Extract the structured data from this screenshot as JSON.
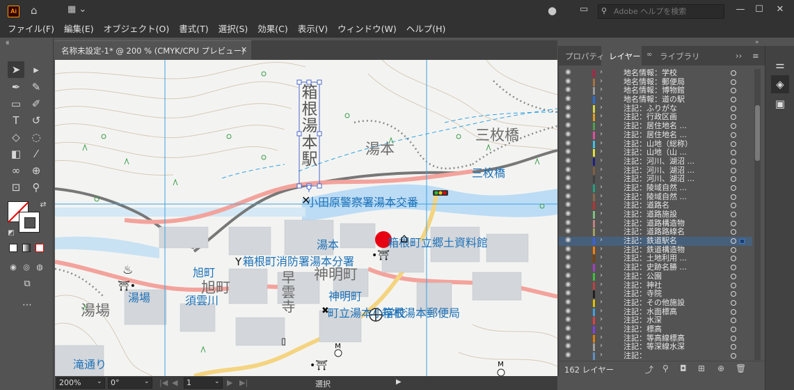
{
  "app": {
    "logo": "Ai",
    "search_placeholder": "Adobe ヘルプを検索"
  },
  "menu": [
    "ファイル(F)",
    "編集(E)",
    "オブジェクト(O)",
    "書式(T)",
    "選択(S)",
    "効果(C)",
    "表示(V)",
    "ウィンドウ(W)",
    "ヘルプ(H)"
  ],
  "document": {
    "tab_label": "名称未設定-1* @ 200 % (CMYK/CPU プレビュー)",
    "close_glyph": "✕"
  },
  "statusbar": {
    "zoom": "200%",
    "rotation": "0°",
    "artboard": "1",
    "mode": "選択"
  },
  "map": {
    "vertical_labels": [
      {
        "text": "箱根湯本駅"
      },
      {
        "text": "早雲寺"
      }
    ],
    "gray_labels": [
      "三枚橋",
      "湯本",
      "旭町",
      "湯場",
      "神明町"
    ],
    "blue_labels": [
      "三枚橋",
      "小田原警察署湯本交番",
      "湯本",
      "箱根町消防署湯本分署",
      "旭町",
      "湯場",
      "須雲川",
      "神明町",
      "町立湯本小学校",
      "箱根湯本郵便局",
      "箱根町立郷土資料館",
      "滝通り"
    ]
  },
  "panel": {
    "tabs": [
      "プロパティ",
      "レイヤー",
      "ライブラリ"
    ],
    "active_tab": "レイヤー",
    "footer_count": "162 レイヤー",
    "layers": [
      {
        "name": "地名情報：学校",
        "color": "#b81f45"
      },
      {
        "name": "地名情報：郵便局",
        "color": "#a87342"
      },
      {
        "name": "地名情報：博物館",
        "color": "#9a9a9a"
      },
      {
        "name": "地名情報：道の駅",
        "color": "#2c6dd6"
      },
      {
        "name": "注記：ふりがな",
        "color": "#d6d640"
      },
      {
        "name": "注記：行政区画",
        "color": "#e0a020"
      },
      {
        "name": "注記：居住地名 ...",
        "color": "#50a050"
      },
      {
        "name": "注記：居住地名 ...",
        "color": "#e050a0"
      },
      {
        "name": "注記：山地（総称）",
        "color": "#40c0e0"
      },
      {
        "name": "注記：山地（山 ...",
        "color": "#e0e040"
      },
      {
        "name": "注記：河川、湖沼 ...",
        "color": "#202080"
      },
      {
        "name": "注記：河川、湖沼 ...",
        "color": "#806040"
      },
      {
        "name": "注記：河川、湖沼 ...",
        "color": "#404040"
      },
      {
        "name": "注記：陵域自然 ...",
        "color": "#20a080"
      },
      {
        "name": "注記：陵域自然 ...",
        "color": "#8a6a4a"
      },
      {
        "name": "注記：道路名",
        "color": "#c03030"
      },
      {
        "name": "注記：道路施設",
        "color": "#80c080"
      },
      {
        "name": "注記：道路構造物",
        "color": "#c08080"
      },
      {
        "name": "注記：道路路線名",
        "color": "#a0a060"
      },
      {
        "name": "注記：鉄道駅名",
        "color": "#4060e0",
        "selected": true
      },
      {
        "name": "注記：鉄道構造物",
        "color": "#ff8000"
      },
      {
        "name": "注記：土地利用 ...",
        "color": "#804000"
      },
      {
        "name": "注記：史跡名勝 ...",
        "color": "#a040c0"
      },
      {
        "name": "注記：公園",
        "color": "#40c040"
      },
      {
        "name": "注記：神社",
        "color": "#c04040"
      },
      {
        "name": "注記：寺院",
        "color": "#202020"
      },
      {
        "name": "注記：その他施設",
        "color": "#e0c000"
      },
      {
        "name": "注記：水面標高",
        "color": "#40a0e0"
      },
      {
        "name": "注記：水深",
        "color": "#e04040"
      },
      {
        "name": "注記：標高",
        "color": "#8040e0"
      },
      {
        "name": "注記：等高線標高",
        "color": "#e08000"
      },
      {
        "name": "注記：等深線水深",
        "color": "#a0a0a0"
      },
      {
        "name": "注記：",
        "color": "#6090c0"
      }
    ]
  }
}
